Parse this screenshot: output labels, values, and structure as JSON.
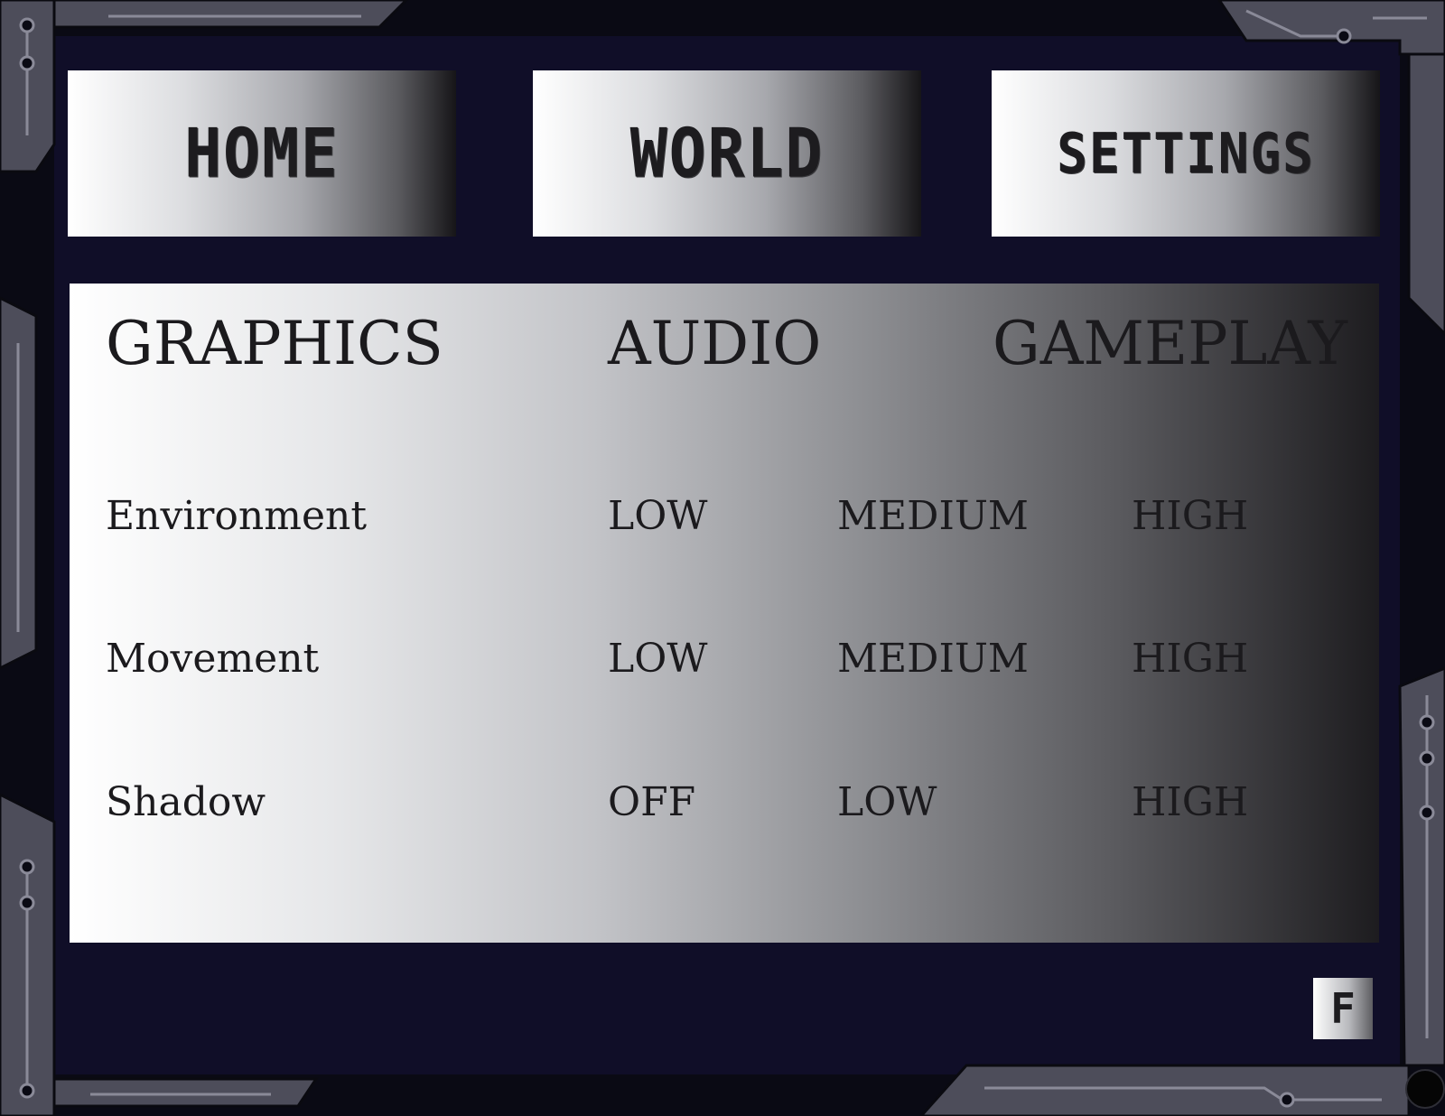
{
  "nav": {
    "home_label": "HOME",
    "world_label": "WORLD",
    "settings_label": "SETTINGS"
  },
  "settings": {
    "tabs": {
      "graphics": "GRAPHICS",
      "audio": "AUDIO",
      "gameplay": "GAMEPLAY"
    },
    "rows": [
      {
        "label": "Environment",
        "options": [
          "LOW",
          "MEDIUM",
          "HIGH"
        ]
      },
      {
        "label": "Movement",
        "options": [
          "LOW",
          "MEDIUM",
          "HIGH"
        ]
      },
      {
        "label": "Shadow",
        "options": [
          "OFF",
          "LOW",
          "HIGH"
        ]
      }
    ]
  },
  "corner_button_label": "F",
  "colors": {
    "background": "#10102a",
    "frame": "#5a5a68",
    "text": "#1b1a1d"
  },
  "icons": {
    "frame_decor": "circuit-frame-icon",
    "corner_knob": "knob-icon"
  }
}
